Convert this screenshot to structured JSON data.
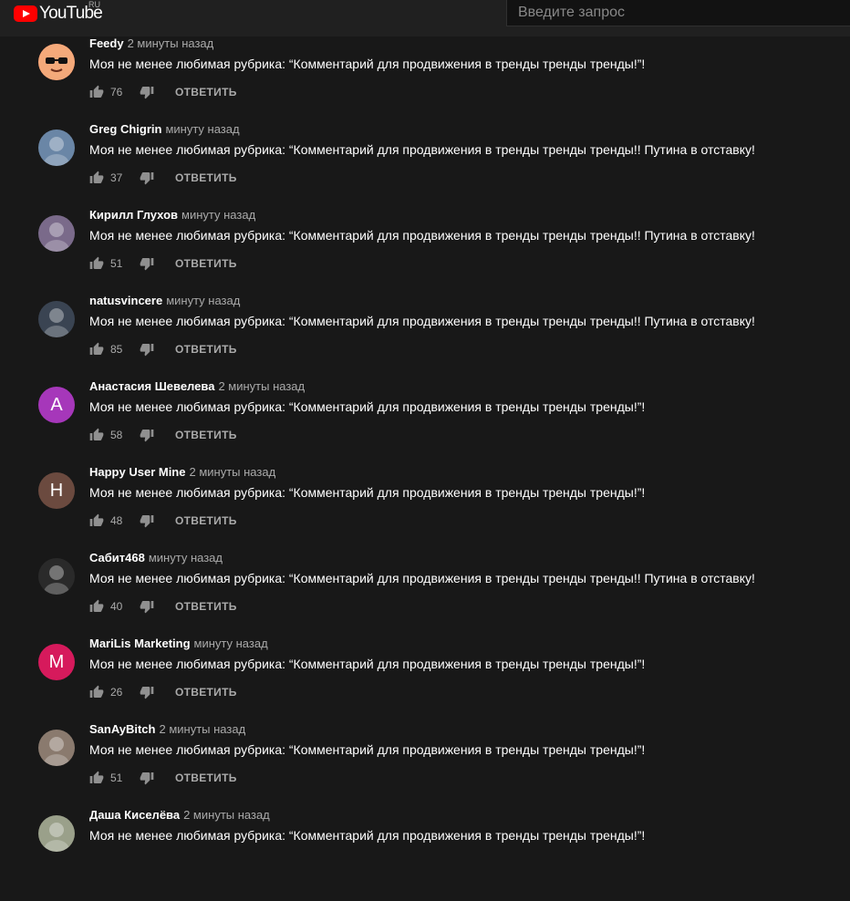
{
  "header": {
    "logo_text": "YouTube",
    "country": "RU",
    "search_placeholder": "Введите запрос"
  },
  "reply_label": "ОТВЕТИТЬ",
  "comments": [
    {
      "author": "Feedy",
      "time": "2 минуты назад",
      "text": "Моя не менее любимая рубрика: “Комментарий для продвижения в тренды тренды тренды!”!",
      "likes": "76",
      "avatar": {
        "letter": "",
        "color": "#f07a5a",
        "icon": "sunglasses-face-avatar"
      }
    },
    {
      "author": "Greg Chigrin",
      "time": "минуту назад",
      "text": "Моя не менее любимая рубрика: “Комментарий для продвижения в тренды тренды тренды!! Путина в отставку!",
      "likes": "37",
      "avatar": {
        "letter": "",
        "color": "#6a86a6",
        "icon": "photo-avatar"
      }
    },
    {
      "author": "Кирилл Глухов",
      "time": "минуту назад",
      "text": "Моя не менее любимая рубрика: “Комментарий для продвижения в тренды тренды тренды!! Путина в отставку!",
      "likes": "51",
      "avatar": {
        "letter": "",
        "color": "#7a6a8a",
        "icon": "photo-avatar"
      }
    },
    {
      "author": "natusvincere",
      "time": "минуту назад",
      "text": "Моя не менее любимая рубрика: “Комментарий для продвижения в тренды тренды тренды!! Путина в отставку!",
      "likes": "85",
      "avatar": {
        "letter": "",
        "color": "#3a4452",
        "icon": "photo-avatar"
      }
    },
    {
      "author": "Анастасия Шевелева",
      "time": "2 минуты назад",
      "text": "Моя не менее любимая рубрика: “Комментарий для продвижения в тренды тренды тренды!”!",
      "likes": "58",
      "avatar": {
        "letter": "А",
        "color": "#a637ba",
        "icon": "letter-avatar"
      }
    },
    {
      "author": "Happy User Mine",
      "time": "2 минуты назад",
      "text": "Моя не менее любимая рубрика: “Комментарий для продвижения в тренды тренды тренды!”!",
      "likes": "48",
      "avatar": {
        "letter": "H",
        "color": "#6b4a3f",
        "icon": "letter-avatar"
      }
    },
    {
      "author": "Сабит468",
      "time": "минуту назад",
      "text": "Моя не менее любимая рубрика: “Комментарий для продвижения в тренды тренды тренды!! Путина в отставку!",
      "likes": "40",
      "avatar": {
        "letter": "",
        "color": "#2a2a2a",
        "icon": "photo-avatar"
      }
    },
    {
      "author": "MariLis Marketing",
      "time": "минуту назад",
      "text": "Моя не менее любимая рубрика: “Комментарий для продвижения в тренды тренды тренды!”!",
      "likes": "26",
      "avatar": {
        "letter": "M",
        "color": "#d61a5c",
        "icon": "letter-avatar"
      }
    },
    {
      "author": "SanAyBitch",
      "time": "2 минуты назад",
      "text": "Моя не менее любимая рубрика: “Комментарий для продвижения в тренды тренды тренды!”!",
      "likes": "51",
      "avatar": {
        "letter": "",
        "color": "#8a7a6e",
        "icon": "photo-avatar"
      }
    },
    {
      "author": "Даша Киселёва",
      "time": "2 минуты назад",
      "text": "Моя не менее любимая рубрика: “Комментарий для продвижения в тренды тренды тренды!”!",
      "likes": "",
      "avatar": {
        "letter": "",
        "color": "#9aa08a",
        "icon": "photo-avatar"
      }
    }
  ]
}
